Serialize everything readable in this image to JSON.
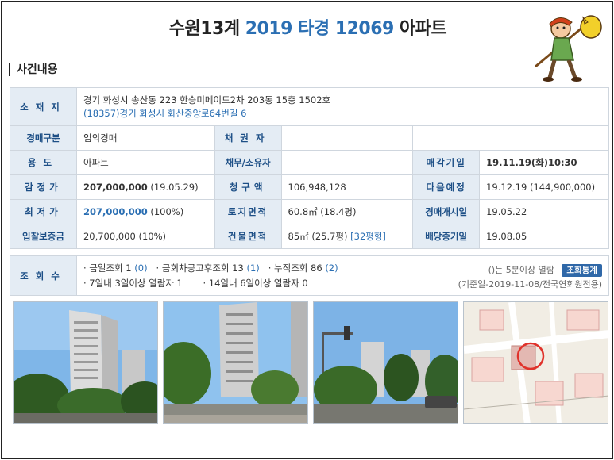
{
  "header": {
    "part1": "수원13계",
    "part2": "2019",
    "part3": "타경",
    "part4": "12069",
    "part5": "아파트"
  },
  "section_title": "사건내용",
  "labels": {
    "location": "소재지",
    "auction_type": "경매구분",
    "creditor": "채권자",
    "usage": "용도",
    "debtor_owner": "채무/소유자",
    "sale_date": "매각기일",
    "appraisal": "감정가",
    "claim_amount": "청구액",
    "next_schedule": "다음예정",
    "minimum_price": "최저가",
    "land_area": "토지면적",
    "auction_start": "경매개시일",
    "deposit": "입찰보증금",
    "building_area": "건물면적",
    "dividend_deadline": "배당종기일",
    "views": "조회수"
  },
  "values": {
    "address_main": "경기 화성시 송산동 223 한승미메이드2차 203동 15층 1502호",
    "address_road": "(18357)경기 화성시 화산중앙로64번길 6",
    "auction_type": "임의경매",
    "creditor": "",
    "usage": "아파트",
    "debtor_owner": "",
    "sale_date": "19.11.19(화)10:30",
    "appraisal_amount": "207,000,000",
    "appraisal_date": "(19.05.29)",
    "claim_amount": "106,948,128",
    "next_schedule": "19.12.19 (144,900,000)",
    "minimum_amount": "207,000,000",
    "minimum_percent": "(100%)",
    "land_area": "60.8㎡ (18.4평)",
    "auction_start": "19.05.22",
    "deposit": "20,700,000 (10%)",
    "building_area": "85㎡ (25.7평)",
    "building_area_pyeong": "[32평형]",
    "dividend_deadline": "19.08.05"
  },
  "views": {
    "today_label": "· 금일조회",
    "today_count": "1",
    "today_sub": "(0)",
    "notice_label": "· 금회차공고후조회",
    "notice_count": "13",
    "notice_sub": "(1)",
    "total_label": "· 누적조회",
    "total_count": "86",
    "total_sub": "(2)",
    "line2": "· 7일내 3일이상 열람자 1       · 14일내 6일이상 열람자 0",
    "note": "()는 5분이상 열람",
    "stats_button": "조회통계",
    "reference": "(기준일-2019-11-08/전국연회원전용)"
  },
  "photos": [
    "building-photo-1",
    "building-photo-2",
    "street-photo",
    "location-map"
  ],
  "colors": {
    "accent": "#2b6fb3",
    "label_bg": "#e4ecf4",
    "label_text": "#1d4f86",
    "button": "#2f68a8"
  }
}
